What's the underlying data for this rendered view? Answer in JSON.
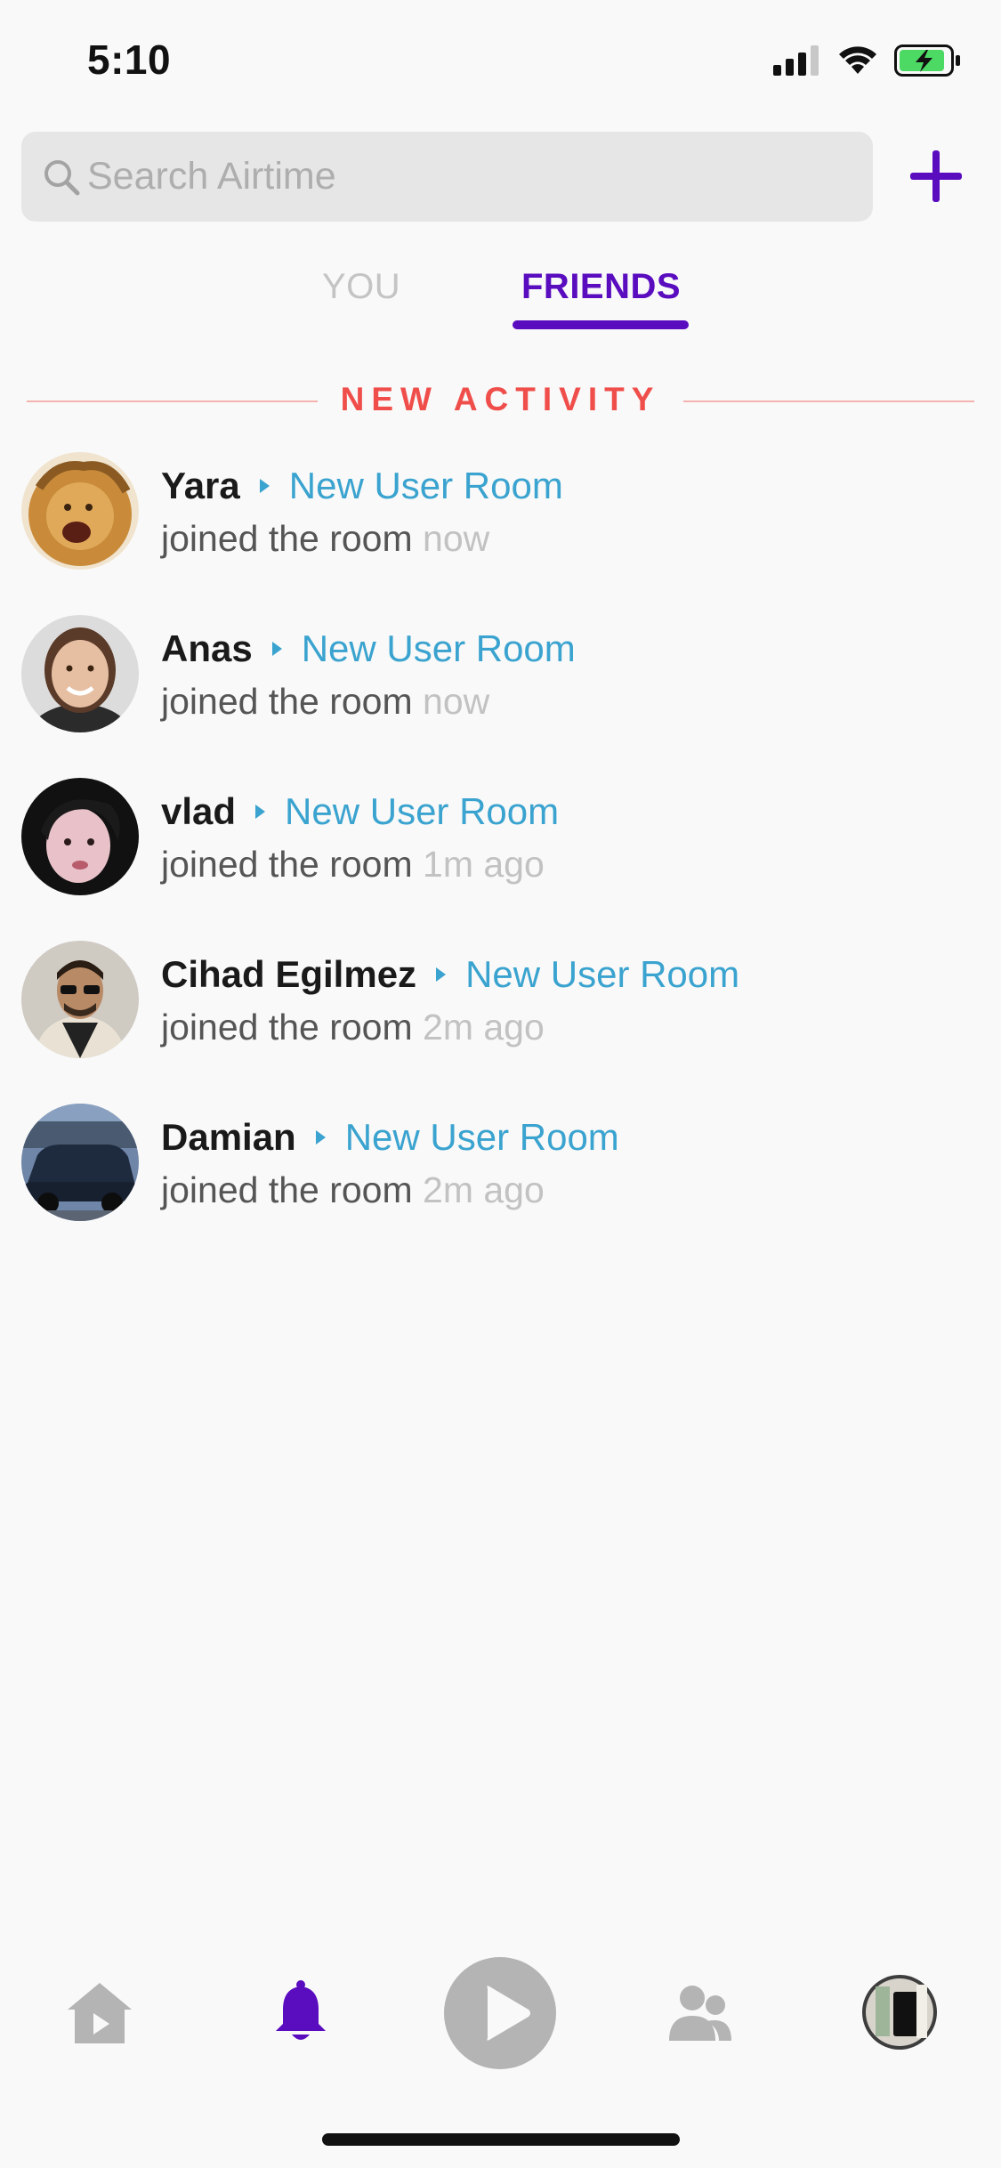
{
  "status_bar": {
    "time": "5:10",
    "icons": [
      "cellular-signal-icon",
      "wifi-icon",
      "battery-charging-icon"
    ]
  },
  "search": {
    "placeholder": "Search Airtime",
    "value": ""
  },
  "header": {
    "add_icon": "plus-icon"
  },
  "tabs": [
    {
      "label": "YOU",
      "active": false
    },
    {
      "label": "FRIENDS",
      "active": true
    }
  ],
  "section": {
    "title": "NEW ACTIVITY"
  },
  "activities": [
    {
      "name": "Yara",
      "room": "New User Room",
      "action": "joined the room",
      "time": "now"
    },
    {
      "name": "Anas",
      "room": "New User Room",
      "action": "joined the room",
      "time": "now"
    },
    {
      "name": "vlad",
      "room": "New User Room",
      "action": "joined the room",
      "time": "1m ago"
    },
    {
      "name": "Cihad Egilmez",
      "room": "New User Room",
      "action": "joined the room",
      "time": "2m ago"
    },
    {
      "name": "Damian",
      "room": "New User Room",
      "action": "joined the room",
      "time": "2m ago"
    }
  ],
  "tab_bar": {
    "items": [
      "home-icon",
      "bell-icon",
      "play-icon",
      "friends-icon",
      "profile-avatar"
    ],
    "active": "bell-icon"
  },
  "colors": {
    "accent": "#5a0cbf",
    "link": "#3aa3cf",
    "alert": "#ef4e4a",
    "muted": "#c2c2c2"
  }
}
